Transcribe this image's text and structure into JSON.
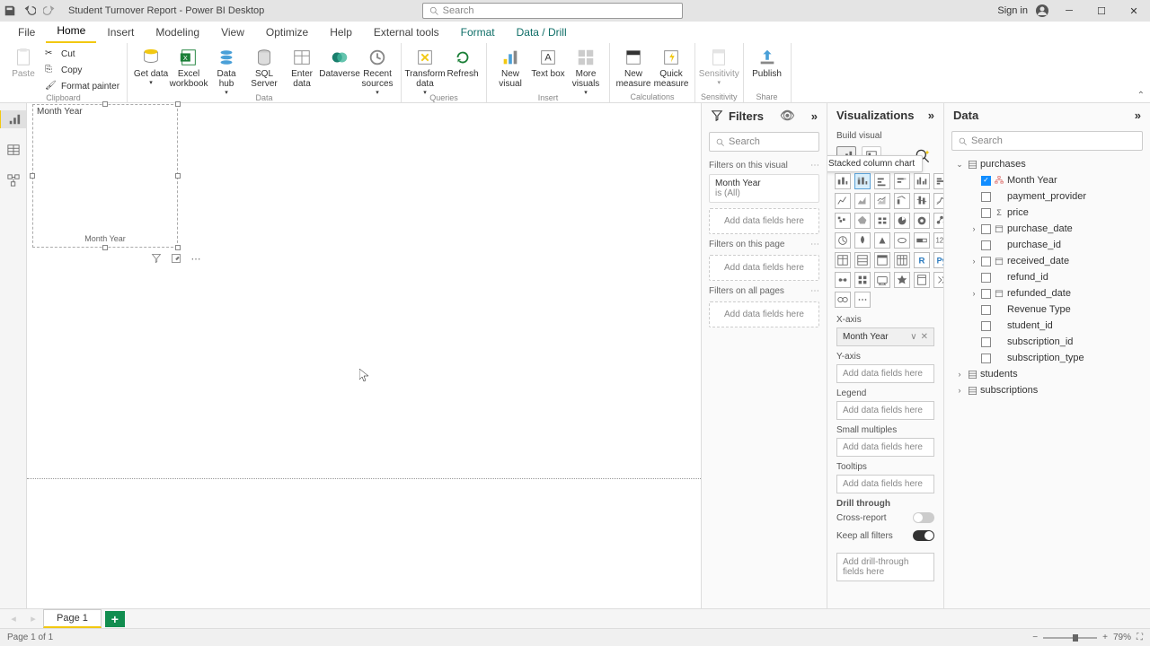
{
  "titlebar": {
    "title": "Student Turnover Report - Power BI Desktop",
    "search_placeholder": "Search",
    "signin": "Sign in"
  },
  "menutabs": [
    "File",
    "Home",
    "Insert",
    "Modeling",
    "View",
    "Optimize",
    "Help",
    "External tools",
    "Format",
    "Data / Drill"
  ],
  "menutabs_active": "Home",
  "menutabs_context": [
    "Format",
    "Data / Drill"
  ],
  "ribbon": {
    "groups": {
      "clipboard": {
        "label": "Clipboard",
        "paste": "Paste",
        "cut": "Cut",
        "copy": "Copy",
        "format_painter": "Format painter"
      },
      "data": {
        "label": "Data",
        "get_data": "Get data",
        "excel": "Excel workbook",
        "datahub": "Data hub",
        "sql": "SQL Server",
        "enter": "Enter data",
        "dataverse": "Dataverse",
        "recent": "Recent sources"
      },
      "queries": {
        "label": "Queries",
        "transform": "Transform data",
        "refresh": "Refresh"
      },
      "insert": {
        "label": "Insert",
        "visual": "New visual",
        "text": "Text box",
        "more": "More visuals"
      },
      "calc": {
        "label": "Calculations",
        "measure": "New measure",
        "quick": "Quick measure"
      },
      "sens": {
        "label": "Sensitivity",
        "sensitivity": "Sensitivity"
      },
      "share": {
        "label": "Share",
        "publish": "Publish"
      }
    }
  },
  "filters": {
    "title": "Filters",
    "search_placeholder": "Search",
    "sections": {
      "visual": {
        "label": "Filters on this visual",
        "card_name": "Month Year",
        "card_cond": "is (All)",
        "add": "Add data fields here"
      },
      "page": {
        "label": "Filters on this page",
        "add": "Add data fields here"
      },
      "all": {
        "label": "Filters on all pages",
        "add": "Add data fields here"
      }
    }
  },
  "viz": {
    "title": "Visualizations",
    "sub": "Build visual",
    "tooltip": "Stacked column chart",
    "fields": {
      "xaxis": {
        "label": "X-axis",
        "value": "Month Year"
      },
      "yaxis": {
        "label": "Y-axis",
        "placeholder": "Add data fields here"
      },
      "legend": {
        "label": "Legend",
        "placeholder": "Add data fields here"
      },
      "small": {
        "label": "Small multiples",
        "placeholder": "Add data fields here"
      },
      "tooltips": {
        "label": "Tooltips",
        "placeholder": "Add data fields here"
      }
    },
    "drill": {
      "label": "Drill through",
      "cross": "Cross-report",
      "keep": "Keep all filters",
      "add": "Add drill-through fields here"
    }
  },
  "data": {
    "title": "Data",
    "search_placeholder": "Search",
    "tables": [
      {
        "name": "purchases",
        "expanded": true,
        "fields": [
          {
            "name": "Month Year",
            "type": "hierarchy",
            "checked": true
          },
          {
            "name": "payment_provider",
            "type": "text"
          },
          {
            "name": "price",
            "type": "number"
          },
          {
            "name": "purchase_date",
            "type": "date",
            "expandable": true
          },
          {
            "name": "purchase_id",
            "type": "text"
          },
          {
            "name": "received_date",
            "type": "date",
            "expandable": true
          },
          {
            "name": "refund_id",
            "type": "text"
          },
          {
            "name": "refunded_date",
            "type": "date",
            "expandable": true
          },
          {
            "name": "Revenue Type",
            "type": "text"
          },
          {
            "name": "student_id",
            "type": "text"
          },
          {
            "name": "subscription_id",
            "type": "text"
          },
          {
            "name": "subscription_type",
            "type": "text"
          }
        ]
      },
      {
        "name": "students",
        "expanded": false
      },
      {
        "name": "subscriptions",
        "expanded": false
      }
    ]
  },
  "canvas": {
    "visual_title": "Month Year",
    "visual_xaxis": "Month Year"
  },
  "pagetabs": {
    "page1": "Page 1"
  },
  "statusbar": {
    "pageinfo": "Page 1 of 1",
    "zoom": "79%"
  }
}
